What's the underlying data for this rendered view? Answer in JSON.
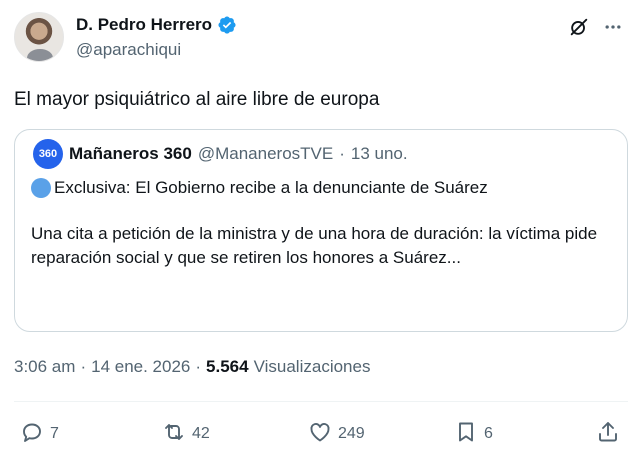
{
  "author": {
    "display_name": "D. Pedro Herrero",
    "handle": "@aparachiqui"
  },
  "tweet_text": "El mayor psiquiátrico al aire libre de europa",
  "quote": {
    "avatar_text": "360",
    "name": "Mañaneros 360",
    "handle": "@MananerosTVE",
    "separator": "·",
    "time": "13 uno.",
    "headline": "Exclusiva: El Gobierno recibe a la denunciante de Suárez",
    "body": "Una cita a petición de la ministra y de una hora de duración: la víctima pide reparación social y que se retiren los honores a Suárez..."
  },
  "meta": {
    "time": "3:06 am",
    "sep1": "·",
    "date": "14 ene. 2026",
    "sep2": "·",
    "views_count": "5.564",
    "views_label": "Visualizaciones"
  },
  "actions": {
    "replies": "7",
    "reposts": "42",
    "likes": "249",
    "bookmarks": "6"
  },
  "colors": {
    "verified": "#1d9bf0",
    "muted": "#536471",
    "text": "#0f1419",
    "quote_avatar": "#2563eb",
    "border": "#cfd9de"
  },
  "icons": [
    "verified-badge-icon",
    "grok-icon",
    "more-icon",
    "reply-icon",
    "repost-icon",
    "like-icon",
    "bookmark-icon",
    "share-icon"
  ]
}
